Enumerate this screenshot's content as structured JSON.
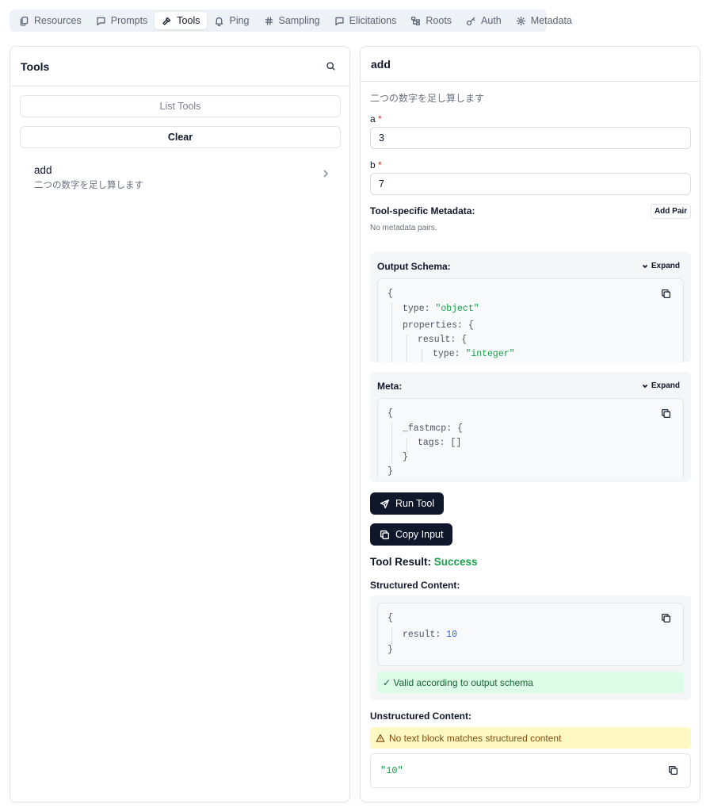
{
  "tabs": [
    {
      "label": "Resources",
      "icon": "files-icon",
      "active": false
    },
    {
      "label": "Prompts",
      "icon": "message-icon",
      "active": false
    },
    {
      "label": "Tools",
      "icon": "hammer-icon",
      "active": true
    },
    {
      "label": "Ping",
      "icon": "bell-icon",
      "active": false
    },
    {
      "label": "Sampling",
      "icon": "hash-icon",
      "active": false
    },
    {
      "label": "Elicitations",
      "icon": "message-icon",
      "active": false
    },
    {
      "label": "Roots",
      "icon": "tree-icon",
      "active": false
    },
    {
      "label": "Auth",
      "icon": "key-icon",
      "active": false
    },
    {
      "label": "Metadata",
      "icon": "gear-icon",
      "active": false
    }
  ],
  "tools_panel": {
    "title": "Tools",
    "list_button": "List Tools",
    "clear_button": "Clear",
    "items": [
      {
        "name": "add",
        "description": "二つの数字を足し算します"
      }
    ]
  },
  "detail": {
    "title": "add",
    "description": "二つの数字を足し算します",
    "params": [
      {
        "name": "a",
        "required_mark": "*",
        "value": "3"
      },
      {
        "name": "b",
        "required_mark": "*",
        "value": "7"
      }
    ],
    "metadata_label": "Tool-specific Metadata:",
    "add_pair": "Add Pair",
    "no_metadata": "No metadata pairs.",
    "output_schema": {
      "title": "Output Schema:",
      "expand": "Expand",
      "lines": [
        {
          "key": "",
          "punct": "{",
          "val": "",
          "type": "plain"
        },
        {
          "key": "type:",
          "punct": "",
          "val": "\"object\"",
          "type": "str"
        },
        {
          "key": "properties:",
          "punct": "{",
          "val": "",
          "type": "plain"
        },
        {
          "key": "result:",
          "punct": "{",
          "val": "",
          "type": "plain"
        },
        {
          "key": "type:",
          "punct": "",
          "val": "\"integer\"",
          "type": "str"
        }
      ]
    },
    "meta": {
      "title": "Meta:",
      "expand": "Expand",
      "lines": [
        {
          "key": "",
          "punct": "{",
          "val": ""
        },
        {
          "key": "_fastmcp:",
          "punct": "{",
          "val": ""
        },
        {
          "key": "tags:",
          "punct": "[]",
          "val": ""
        },
        {
          "key": "",
          "punct": "}",
          "val": ""
        },
        {
          "key": "",
          "punct": "}",
          "val": ""
        }
      ]
    },
    "run_button": "Run Tool",
    "copy_button": "Copy Input",
    "result_label": "Tool Result:",
    "result_status": "Success",
    "structured_label": "Structured Content:",
    "structured": {
      "open": "{",
      "key": "result:",
      "value": "10",
      "close": "}"
    },
    "valid_text": "✓ Valid according to output schema",
    "unstructured_label": "Unstructured Content:",
    "warning_text": "No text block matches structured content",
    "raw_text": "\"10\""
  }
}
